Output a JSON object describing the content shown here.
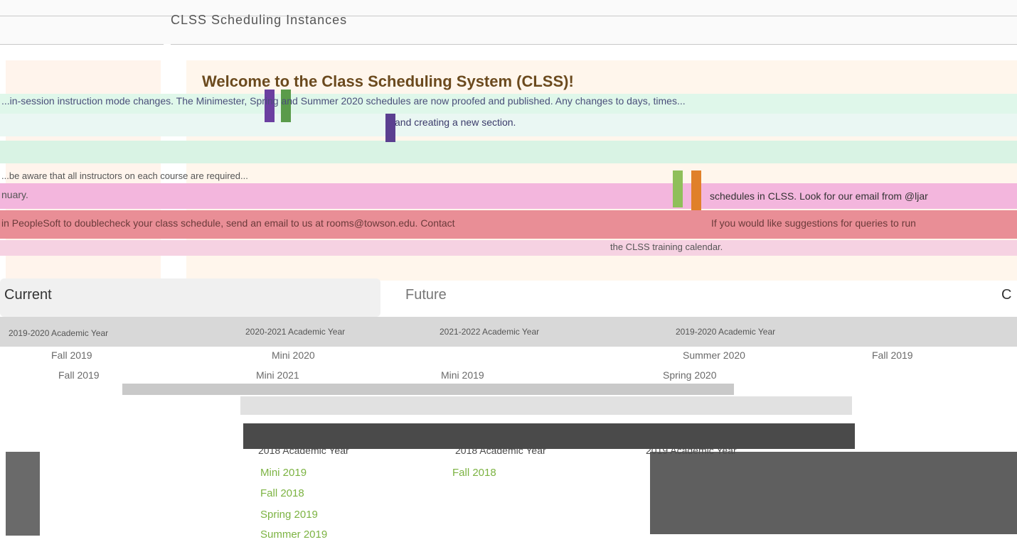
{
  "site": {
    "title": "CLSS Scheduling Instances"
  },
  "welcome": {
    "heading": "Welcome to the Class Scheduling System (CLSS)!"
  },
  "notices": [
    "...in-session instruction mode changes. The Minimester, Spring and Summer 2020 schedules are now proofed and published. Any changes to days, times...",
    "and creating a new section.",
    "...be aware that all instructors on each course are required...",
    "nuary.",
    "schedules in CLSS. Look for our email from @ljar",
    "in PeopleSoft to doublecheck your class schedule, send an email to us at rooms@towson.edu. Contact",
    "If you would like suggestions for queries to run",
    "the CLSS training calendar."
  ],
  "cards": {
    "current": "Current",
    "future": "Future",
    "other": "C"
  },
  "academic_years": [
    "2019-2020 Academic Year",
    "2020-2021 Academic Year",
    "2021-2022 Academic Year",
    "2019-2020 Academic Year"
  ],
  "terms": {
    "row1": [
      "Fall 2019",
      "Mini 2020",
      "Summer 2020",
      "Fall 2019"
    ],
    "row2": [
      "Fall 2019",
      "Mini 2021",
      "Mini 2019",
      "Spring 2020"
    ]
  },
  "past": {
    "years": [
      "2018 Academic Year",
      "2018 Academic Year",
      "2019 Academic Year"
    ],
    "links_col1": [
      "Mini 2019",
      "Fall 2018",
      "Spring 2019",
      "Summer 2019"
    ],
    "links_col2": [
      "Fall 2018"
    ]
  },
  "colors": {
    "accent_green": "#7cb342",
    "heading": "#6b4a1e"
  }
}
